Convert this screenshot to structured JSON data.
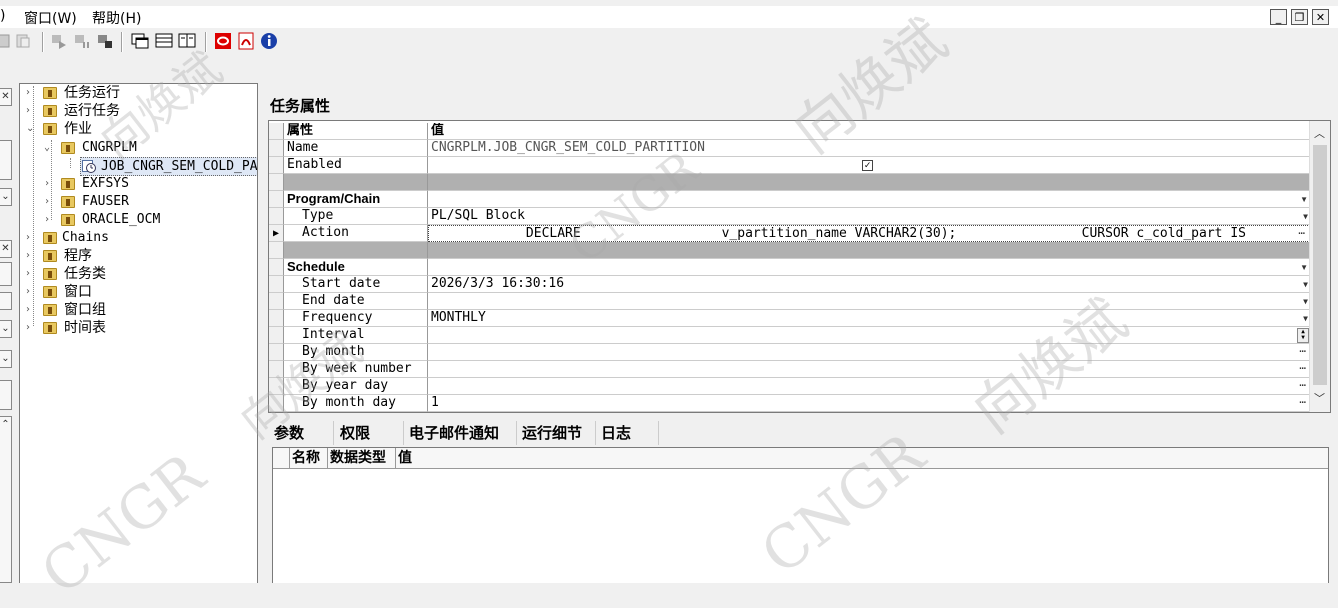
{
  "menu": {
    "partial_paren": ")",
    "window": "窗口(W)",
    "help": "帮助(H)"
  },
  "window_controls": {
    "minimize": "_",
    "restore": "❐",
    "close": "✕"
  },
  "toolbar": {
    "icons": [
      "save-icon",
      "copy-icon",
      "run-icon",
      "pause-icon",
      "stop-icon",
      "window-icon",
      "grid-icon",
      "split-icon",
      "oracle-icon",
      "pdf-icon",
      "info-icon"
    ]
  },
  "tree": {
    "items": [
      {
        "label": "任务运行"
      },
      {
        "label": "运行任务"
      },
      {
        "label": "作业"
      },
      {
        "label": "CNGRPLM"
      },
      {
        "label": "JOB_CNGR_SEM_COLD_PA"
      },
      {
        "label": "EXFSYS"
      },
      {
        "label": "FAUSER"
      },
      {
        "label": "ORACLE_OCM"
      },
      {
        "label": "Chains"
      },
      {
        "label": "程序"
      },
      {
        "label": "任务类"
      },
      {
        "label": "窗口"
      },
      {
        "label": "窗口组"
      },
      {
        "label": "时间表"
      }
    ]
  },
  "properties": {
    "title": "任务属性",
    "col_name": "属性",
    "col_value": "值",
    "rows": {
      "name": {
        "label": "Name",
        "value": "CNGRPLM.JOB_CNGR_SEM_COLD_PARTITION"
      },
      "enabled": {
        "label": "Enabled",
        "value": "✓"
      },
      "program_chain": {
        "label": "Program/Chain"
      },
      "type": {
        "label": "Type",
        "value": "PL/SQL Block"
      },
      "action": {
        "label": "Action",
        "value": "            DECLARE                  v_partition_name VARCHAR2(30);                CURSOR c_cold_part IS"
      },
      "schedule": {
        "label": "Schedule"
      },
      "start_date": {
        "label": "Start date",
        "value": "2026/3/3 16:30:16"
      },
      "end_date": {
        "label": "End date",
        "value": ""
      },
      "frequency": {
        "label": "Frequency",
        "value": "MONTHLY"
      },
      "interval": {
        "label": "Interval",
        "value": ""
      },
      "by_month": {
        "label": "By month",
        "value": ""
      },
      "by_week_number": {
        "label": "By week number",
        "value": ""
      },
      "by_year_day": {
        "label": "By year day",
        "value": ""
      },
      "by_month_day": {
        "label": "By month day",
        "value": "1"
      }
    }
  },
  "tabs": [
    "参数",
    "权限",
    "电子邮件通知",
    "运行细节",
    "日志"
  ],
  "params_table": {
    "headers": [
      "名称",
      "数据类型",
      "值"
    ]
  },
  "watermarks": {
    "text_cn": "向焕斌",
    "text_en": "CNGR"
  }
}
